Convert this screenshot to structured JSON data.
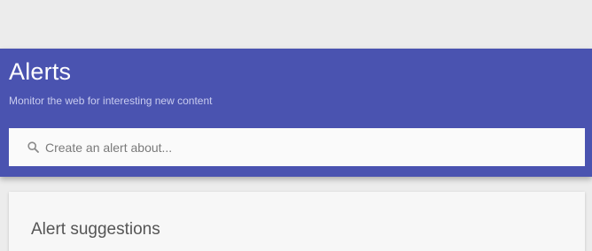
{
  "header": {
    "title": "Alerts",
    "subtitle": "Monitor the web for interesting new content",
    "background_color": "#4a53b0"
  },
  "search": {
    "placeholder": "Create an alert about...",
    "value": "",
    "icon": "search-icon"
  },
  "suggestions": {
    "title": "Alert suggestions"
  }
}
